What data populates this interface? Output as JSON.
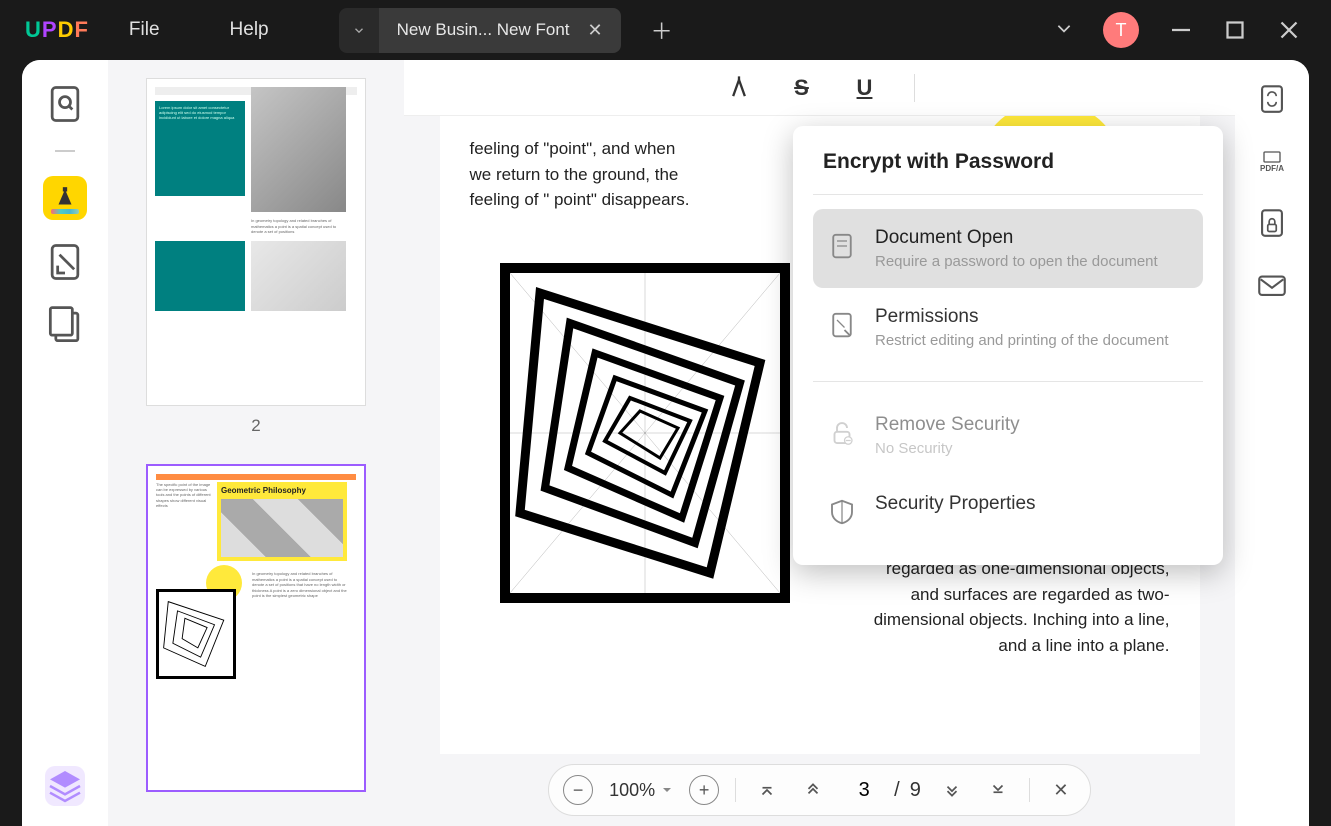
{
  "logo": {
    "u": "U",
    "p": "P",
    "d": "D",
    "f": "F"
  },
  "menu": {
    "file": "File",
    "help": "Help"
  },
  "tab": {
    "title": "New Busin... New Font"
  },
  "avatar": {
    "initial": "T"
  },
  "thumbnails": {
    "label2": "2"
  },
  "thumb3": {
    "heading": "Geometric Philosophy"
  },
  "doc": {
    "leftText": "feeling of \"point\", and when we return to the ground, the feeling of \" point\" disappears.",
    "rightText": "regarded as one-dimensional objects, and surfaces are regarded as two-dimensional objects. Inching into a line, and a line into a plane."
  },
  "pageControls": {
    "zoom": "100%",
    "current": "3",
    "sep": "/",
    "total": "9"
  },
  "encrypt": {
    "title": "Encrypt with Password",
    "documentOpen": {
      "title": "Document Open",
      "sub": "Require a password to open the document"
    },
    "permissions": {
      "title": "Permissions",
      "sub": "Restrict editing and printing of the document"
    },
    "removeSecurity": {
      "title": "Remove Security",
      "sub": "No Security"
    },
    "securityProperties": {
      "title": "Security Properties"
    }
  },
  "rightSidebar": {
    "pdfA": "PDF/A"
  }
}
